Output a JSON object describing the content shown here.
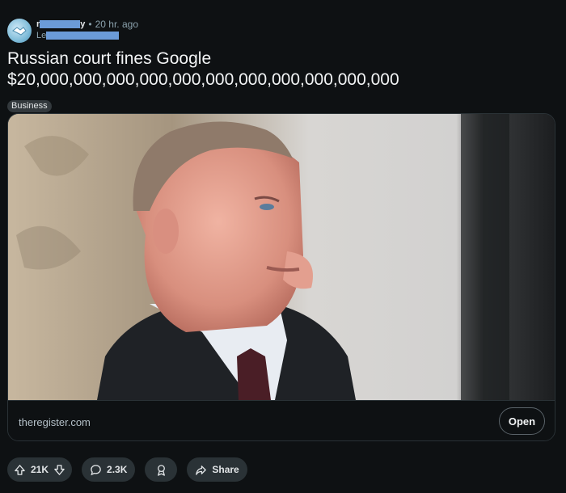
{
  "post": {
    "subreddit_prefix": "r",
    "subreddit_suffix": "y",
    "separator": "•",
    "time": "20 hr. ago",
    "user_prefix": "Le",
    "title": "Russian court fines Google $20,000,000,000,000,000,000,000,000,000,000,000",
    "flair": "Business"
  },
  "link": {
    "domain": "theregister.com",
    "open_label": "Open"
  },
  "actions": {
    "upvotes": "21K",
    "comments": "2.3K",
    "share_label": "Share"
  },
  "icons": {
    "avatar": "handshake-icon",
    "upvote": "arrow-up-icon",
    "downvote": "arrow-down-icon",
    "comment": "comment-bubble-icon",
    "award": "award-icon",
    "share": "share-arrow-icon"
  },
  "colors": {
    "background": "#0e1113",
    "pill": "#2a3236",
    "redaction": "#6b9bd8"
  }
}
